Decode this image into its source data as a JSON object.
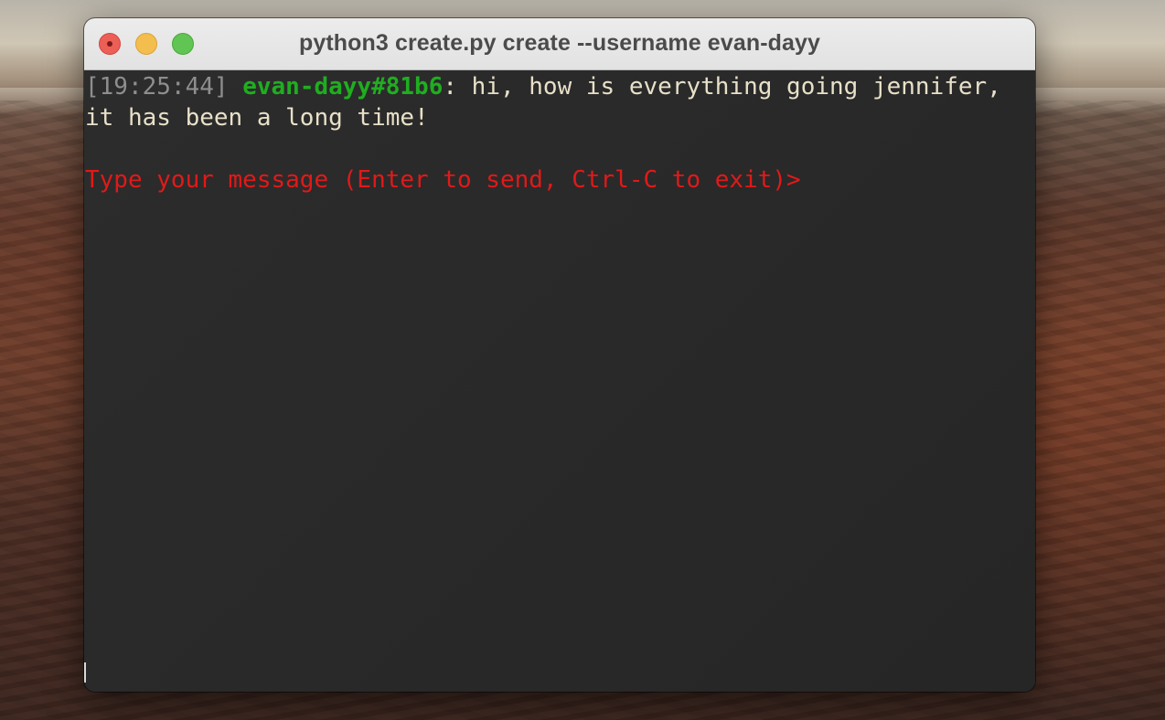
{
  "window": {
    "title": "python3 create.py create --username evan-dayy"
  },
  "terminal": {
    "message": {
      "timestamp": "[19:25:44]",
      "username": "evan-dayy#81b6",
      "separator": ":",
      "text_line1": " hi, how is everything going jennifer,",
      "text_line2": "it has been a long time!"
    },
    "prompt": "Type your message (Enter to send, Ctrl-C to exit)>"
  },
  "colors": {
    "timestamp": "#8e8e8e",
    "username": "#1fae1f",
    "message_text": "#e8e0c8",
    "prompt": "#e11919",
    "terminal_bg": "#2a2a2a"
  }
}
